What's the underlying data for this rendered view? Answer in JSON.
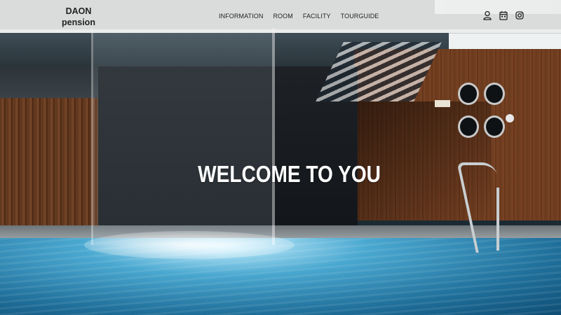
{
  "header": {
    "logo_line1": "DAON",
    "logo_line2": "pension",
    "nav": [
      "INFORMATION",
      "ROOM",
      "FACILITY",
      "TOURGUIDE"
    ],
    "icons": [
      "user-icon",
      "calendar-icon",
      "instagram-icon"
    ]
  },
  "hero": {
    "headline": "WELCOME TO YOU"
  },
  "colors": {
    "header_bg": "#f0f0ee",
    "text_dark": "#222222",
    "headline": "#ffffff",
    "pool": "#1f6f9a",
    "wood": "#6a3a1e"
  }
}
